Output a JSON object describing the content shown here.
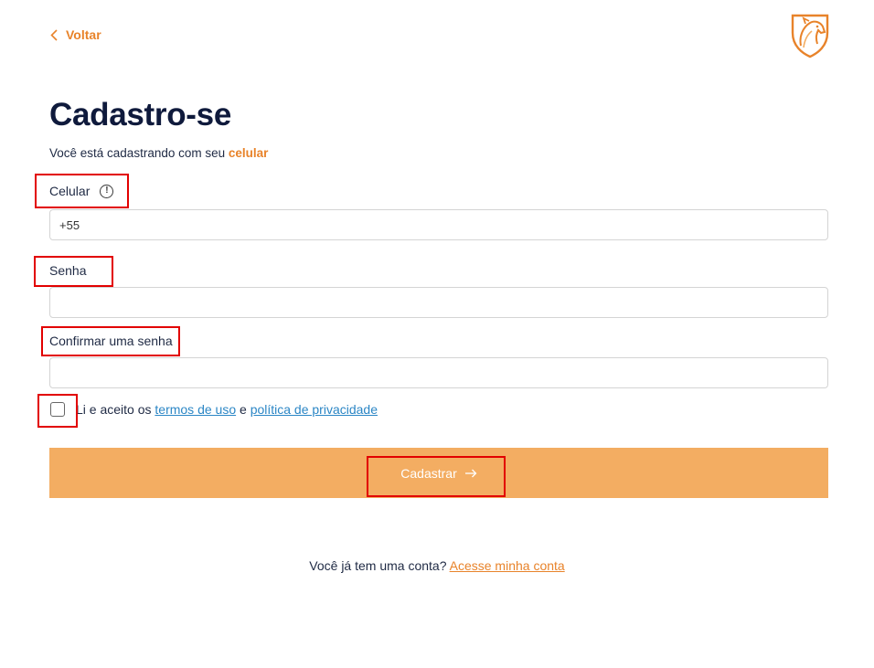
{
  "header": {
    "back_label": "Voltar"
  },
  "form": {
    "title": "Cadastro-se",
    "subtitle_prefix": "Você está cadastrando com seu",
    "subtitle_accent": "celular",
    "phone": {
      "label": "Celular",
      "info_glyph": "!",
      "value": "+55"
    },
    "password": {
      "label": "Senha",
      "value": ""
    },
    "confirm_password": {
      "label": "Confirmar uma senha",
      "value": ""
    },
    "terms": {
      "checked": false,
      "prefix": "Li e aceito os",
      "terms_link": "termos de uso",
      "conjunction": "e",
      "privacy_link": "política de privacidade"
    },
    "submit_label": "Cadastrar",
    "submit_icon": "arrow-right-icon"
  },
  "footer": {
    "question": "Você já tem uma conta?",
    "login_link": "Acesse minha conta"
  },
  "colors": {
    "accent": "#e8832a",
    "button": "#f3ad62",
    "title": "#0f1a3c",
    "link": "#2b86c5",
    "highlight": "#e20000"
  }
}
